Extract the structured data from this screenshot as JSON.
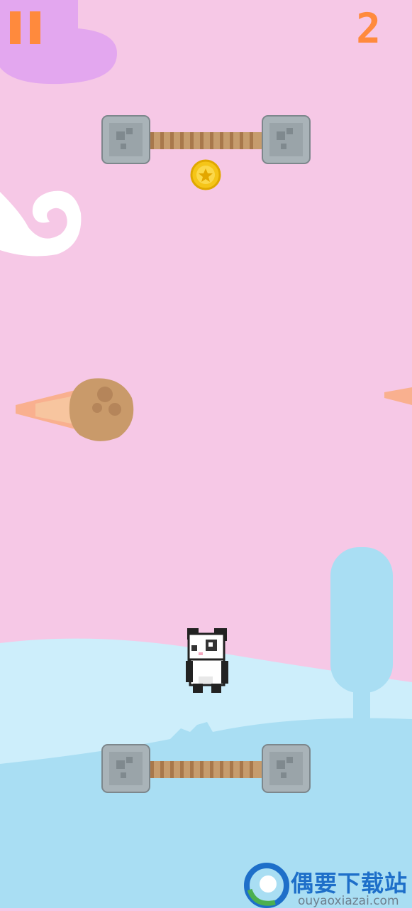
{
  "hud": {
    "score": "2",
    "pause_icon": "pause-icon"
  },
  "colors": {
    "sky": "#f6c8e6",
    "accent": "#ff8a3d",
    "hills": "#a9def3",
    "stone": "#a9b3b8",
    "rope": "#c69c6d",
    "coin": "#f5c518"
  },
  "watermark": {
    "title": "偶要下载站",
    "url": "ouyaoxiazai.com"
  }
}
